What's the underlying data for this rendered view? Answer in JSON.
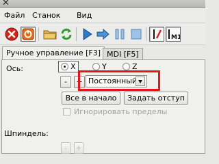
{
  "menubar": {
    "items": [
      "Файл",
      "Станок",
      "Вид"
    ]
  },
  "toolbar": {
    "buttons": [
      "estop-icon",
      "power-icon",
      "open-folder-icon",
      "reload-icon",
      "run-icon",
      "step-icon",
      "pause-icon",
      "stop-icon",
      "block-delete-icon",
      "optional-stop-icon"
    ],
    "optional_stop_label": "M1"
  },
  "tabs": {
    "manual": "Ручное управление [F3]",
    "mdi": "MDI [F5]"
  },
  "axis": {
    "label": "Ось:",
    "options": [
      "X",
      "Y",
      "Z"
    ],
    "selected": "X"
  },
  "jog": {
    "minus": "-",
    "plus": "+",
    "mode_value": "Постоянный"
  },
  "actions": {
    "home": "Все в начало",
    "touch_off": "Задать отступ"
  },
  "override_limits": {
    "label": "Игнорировать пределы",
    "checked": false,
    "enabled": false
  },
  "spindle": {
    "label": "Шпиндель:",
    "minus": "-",
    "plus": "+"
  },
  "colors": {
    "highlight": "#e3141b",
    "estop": "#d7241b",
    "power": "#e36a12",
    "run": "#2f78c8"
  }
}
